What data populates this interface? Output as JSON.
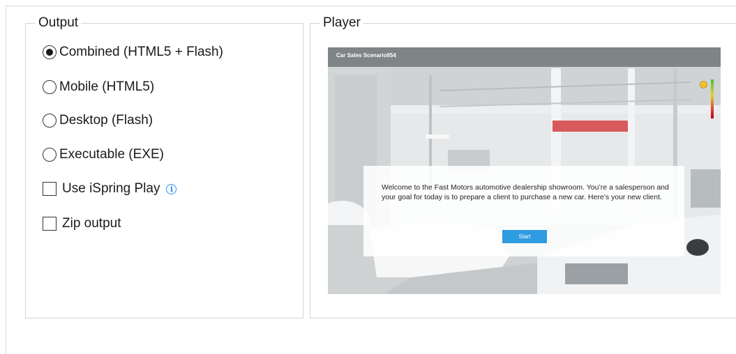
{
  "output": {
    "legend": "Output",
    "options": [
      {
        "label": "Combined (HTML5 + Flash)",
        "selected": true
      },
      {
        "label": "Mobile (HTML5)",
        "selected": false
      },
      {
        "label": "Desktop (Flash)",
        "selected": false
      },
      {
        "label": "Executable (EXE)",
        "selected": false
      }
    ],
    "checkboxes": [
      {
        "label": "Use iSpring Play",
        "checked": false,
        "has_info": true
      },
      {
        "label": "Zip output",
        "checked": false
      }
    ]
  },
  "player": {
    "legend": "Player",
    "preview": {
      "title": "Car Sales Scenario654",
      "message": "Welcome to the Fast Motors automotive dealership showroom. You’re a salesperson and your goal for today is to prepare a client to purchase a new car. Here’s your new client.",
      "start_label": "Start"
    }
  },
  "colors": {
    "accent": "#2f9be0",
    "info": "#2a8ee8"
  },
  "icons": {
    "info": "info-icon",
    "mood": "smiley-icon"
  }
}
